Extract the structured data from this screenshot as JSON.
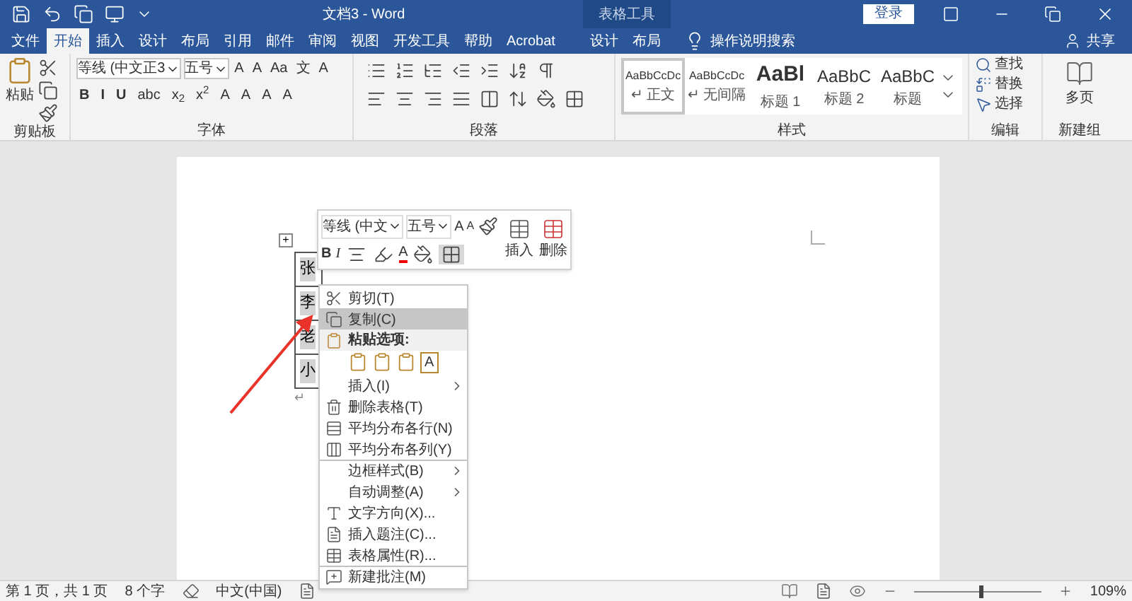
{
  "title_bar": {
    "title": "文档3  -  Word",
    "context_group": "表格工具",
    "login": "登录"
  },
  "tabs": [
    {
      "label": "文件",
      "selected": false
    },
    {
      "label": "开始",
      "selected": true
    },
    {
      "label": "插入",
      "selected": false
    },
    {
      "label": "设计",
      "selected": false
    },
    {
      "label": "布局",
      "selected": false
    },
    {
      "label": "引用",
      "selected": false
    },
    {
      "label": "邮件",
      "selected": false
    },
    {
      "label": "审阅",
      "selected": false
    },
    {
      "label": "视图",
      "selected": false
    },
    {
      "label": "开发工具",
      "selected": false
    },
    {
      "label": "帮助",
      "selected": false
    },
    {
      "label": "Acrobat",
      "selected": false
    }
  ],
  "context_tabs": [
    {
      "label": "设计",
      "selected": false
    },
    {
      "label": "布局",
      "selected": false
    }
  ],
  "tell_me": "操作说明搜索",
  "share": "共享",
  "ribbon": {
    "clipboard": {
      "paste": "粘贴",
      "label": "剪贴板"
    },
    "font": {
      "font_name": "等线 (中文正3",
      "font_size": "五号",
      "row1": [
        "A",
        "A",
        "Aa",
        "文",
        "A"
      ],
      "row2": [
        "B",
        "I",
        "U",
        "abc",
        "x$_{2}$",
        "x$^{2}$",
        "A",
        "A",
        "A",
        "A"
      ],
      "label": "字体"
    },
    "paragraph": {
      "label": "段落"
    },
    "styles": {
      "items": [
        {
          "sample": "AaBbCcDc",
          "name": "↵ 正文",
          "selected": true
        },
        {
          "sample": "AaBbCcDc",
          "name": "↵ 无间隔",
          "selected": false
        },
        {
          "sample": "AaBl",
          "name": "标题 1",
          "selected": false
        },
        {
          "sample": "AaBbC",
          "name": "标题 2",
          "selected": false
        },
        {
          "sample": "AaBbC",
          "name": "标题",
          "selected": false
        }
      ],
      "label": "样式"
    },
    "editing": {
      "items": [
        "查找",
        "替换",
        "选择"
      ],
      "label": "编辑"
    },
    "new_group": {
      "button": "多页",
      "label": "新建组"
    }
  },
  "document": {
    "table_move_handle": "+",
    "table_cells": [
      "张",
      "李",
      "老",
      "小"
    ],
    "paragraph_mark": "↵"
  },
  "mini_toolbar": {
    "font_name": "等线 (中文",
    "font_size": "五号",
    "grow": "A",
    "shrink": "A",
    "bold": "B",
    "italic": "I",
    "font_color": "A",
    "insert": "插入",
    "delete": "删除"
  },
  "context_menu": [
    {
      "label": "剪切(T)",
      "kind": "item",
      "selected": false,
      "submenu": false,
      "divider_above": false
    },
    {
      "label": "复制(C)",
      "kind": "item",
      "selected": true,
      "submenu": false,
      "divider_above": false
    },
    {
      "label": "粘贴选项:",
      "kind": "header"
    },
    {
      "label": "A",
      "kind": "paste_options"
    },
    {
      "label": "插入(I)",
      "kind": "item",
      "selected": false,
      "submenu": true,
      "divider_above": false
    },
    {
      "label": "删除表格(T)",
      "kind": "item",
      "selected": false,
      "submenu": false,
      "divider_above": false
    },
    {
      "label": "平均分布各行(N)",
      "kind": "item",
      "selected": false,
      "submenu": false,
      "divider_above": false
    },
    {
      "label": "平均分布各列(Y)",
      "kind": "item",
      "selected": false,
      "submenu": false,
      "divider_above": false
    },
    {
      "label": "边框样式(B)",
      "kind": "item",
      "selected": false,
      "submenu": true,
      "divider_above": true
    },
    {
      "label": "自动调整(A)",
      "kind": "item",
      "selected": false,
      "submenu": true,
      "divider_above": false
    },
    {
      "label": "文字方向(X)...",
      "kind": "item",
      "selected": false,
      "submenu": false,
      "divider_above": false
    },
    {
      "label": "插入题注(C)...",
      "kind": "item",
      "selected": false,
      "submenu": false,
      "divider_above": false
    },
    {
      "label": "表格属性(R)...",
      "kind": "item",
      "selected": false,
      "submenu": false,
      "divider_above": false
    },
    {
      "label": "新建批注(M)",
      "kind": "item",
      "selected": false,
      "submenu": false,
      "divider_above": true
    }
  ],
  "status_bar": {
    "page": "第 1 页，共 1 页",
    "words": "8 个字",
    "language": "中文(中国)",
    "zoom": {
      "level": 0.52,
      "reading": "109%"
    }
  }
}
